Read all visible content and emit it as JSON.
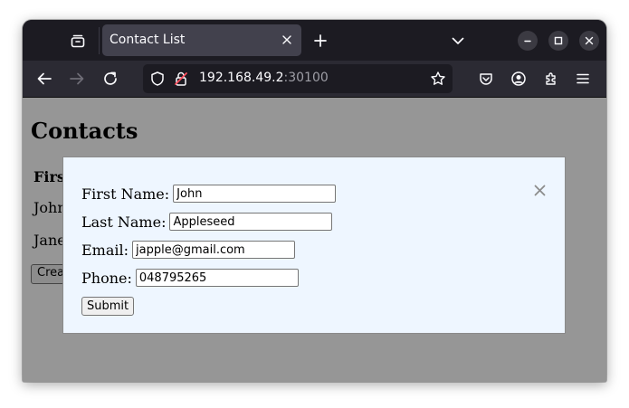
{
  "browser": {
    "tab_title": "Contact List",
    "url_host": "192.168.49.2",
    "url_port": ":30100"
  },
  "page": {
    "title": "Contacts",
    "column_header": "Firs",
    "rows": [
      "John",
      "Jane"
    ],
    "create_button": "Crea"
  },
  "modal": {
    "first_name_label": "First Name:",
    "first_name_value": "John",
    "last_name_label": "Last Name:",
    "last_name_value": "Appleseed",
    "email_label": "Email:",
    "email_value": "japple@gmail.com",
    "phone_label": "Phone:",
    "phone_value": "048795265",
    "submit_label": "Submit",
    "close_icon": "close-icon"
  },
  "colors": {
    "chrome_dark": "#1c1b22",
    "toolbar": "#2b2a33",
    "modal_bg": "#eef6ff",
    "overlay": "rgba(0,0,0,0.41)"
  }
}
